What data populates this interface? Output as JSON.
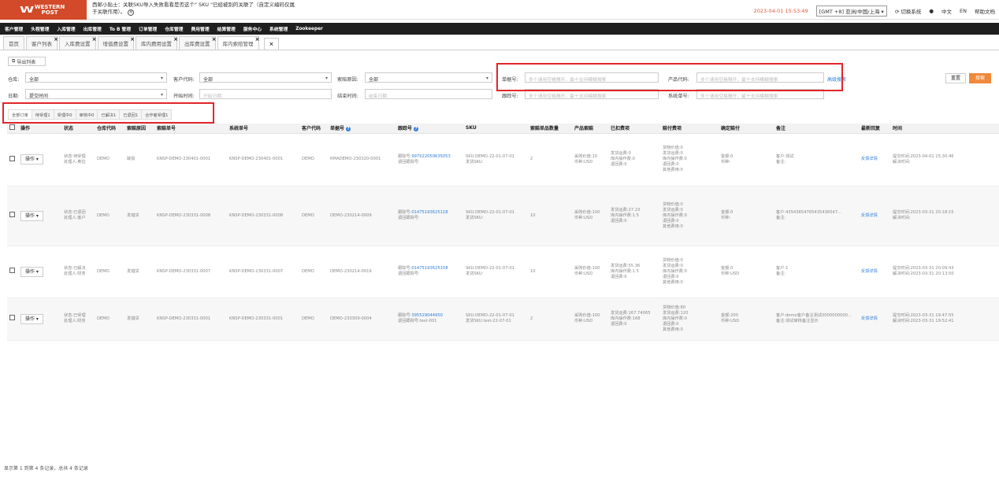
{
  "header": {
    "logo_top": "WESTERN",
    "logo_bottom": "POST",
    "tip": "西邮小贴士：关联SKU导入失败看看是否这个\" SKU \"已经被别的关联了（自定义编码仅属于关联作用）。",
    "datetime": "2023-04-01 15:53:49",
    "timezone": "[GMT +8] 亚洲/中国/上海",
    "switch_system": "切换系统",
    "lang_zh": "中文",
    "lang_en": "EN",
    "help_doc": "帮助文档"
  },
  "nav": [
    "客户管理",
    "头程管理",
    "入库管理",
    "出库管理",
    "To B 管理",
    "订单管理",
    "仓库管理",
    "费用管理",
    "结算管理",
    "服务中心",
    "系统管理",
    "Zookeeper"
  ],
  "tabs": [
    {
      "label": "首页"
    },
    {
      "label": "客户列表"
    },
    {
      "label": "入库费设置"
    },
    {
      "label": "增值费设置"
    },
    {
      "label": "库内费用设置"
    },
    {
      "label": "出库费设置"
    },
    {
      "label": "库内索赔管理"
    }
  ],
  "toolbar": {
    "export": "导出列表"
  },
  "filters": {
    "warehouse_label": "仓库:",
    "warehouse_value": "全部",
    "customer_label": "客户代码:",
    "customer_value": "全部",
    "reason_label": "索赔原因:",
    "reason_value": "全部",
    "order_label": "单据号:",
    "order_ph": "多个请用空格隔开，最十支持模糊搜索",
    "product_label": "产品代码:",
    "product_ph": "多个请用空格隔开，最十支持模糊搜索",
    "advanced": "高级搜索",
    "reset": "重置",
    "search": "搜索",
    "date_label": "日期:",
    "date_value": "提交时间",
    "start_label": "开始时间:",
    "start_ph": "开始日期",
    "end_label": "结束时间:",
    "end_ph": "结束日期",
    "tracking_label": "跟踪号:",
    "tracking_ph": "多个请用空格隔开，最十支持模糊搜索",
    "system_label": "系统单号:",
    "system_ph": "多个请用空格隔开，最十支持模糊搜索"
  },
  "status_tabs": [
    "全部订单",
    "待受理1",
    "受理中0",
    "审核中0",
    "已解决1",
    "已退回1",
    "合作者受理1"
  ],
  "columns": [
    "操作",
    "状态",
    "仓库代码",
    "索赔原因",
    "索赔单号",
    "系统单号",
    "客户代码",
    "单据号",
    "跟踪号",
    "SKU",
    "索赔单品数量",
    "产品索赔",
    "已扣费项",
    "赔付费项",
    "确定赔付",
    "备注",
    "最新回复",
    "时间"
  ],
  "rows": [
    {
      "op": "操作",
      "status": [
        "状态:待受理",
        "处理人:奥拉"
      ],
      "warehouse": "DEMO",
      "reason": "破损",
      "claim_no": "KNSP-DEMO-230401-0001",
      "system_no": "KNSP-DEMO-230401-0001",
      "customer": "DEMO",
      "order_no": "RMADEMO-230320-0001",
      "track_label": "跟踪号:",
      "track_no": "997022050635053",
      "return_track": "退回跟踪号:",
      "sku": [
        "SKU:DEMO-22-01-07-01",
        "发货SKU:"
      ],
      "qty": "2",
      "product_claim": [
        "采购价值:10",
        "币种:USD"
      ],
      "deducted": [
        "发货运费:0",
        "库内操作费:0",
        "退回费:0"
      ],
      "compensation": [
        "货物价值:0",
        "发货运费:0",
        "库内操作费:0",
        "退回费:0",
        "其他费用:0"
      ],
      "confirmed": [
        "金额:0",
        "币种:"
      ],
      "remark": [
        "客户:测试",
        "备注:"
      ],
      "reply": "反馈详情",
      "time": [
        "提交时间:2023-04-01 15:30:46",
        "解决时间:"
      ]
    },
    {
      "op": "操作",
      "status": [
        "状态:已退回",
        "处理人:客户"
      ],
      "warehouse": "DEMO",
      "reason": "发错货",
      "claim_no": "KNSP-DEMO-230331-0008",
      "system_no": "KNSP-DEMO-230331-0008",
      "customer": "DEMO",
      "order_no": "DEMO-230214-0009",
      "track_label": "跟踪号:",
      "track_no": "01475193625118",
      "return_track": "退回跟踪号:",
      "sku": [
        "SKU:DEMO-22-01-07-01",
        "发货SKU:"
      ],
      "qty": "10",
      "product_claim": [
        "采购价值:100",
        "币种:USD"
      ],
      "deducted": [
        "发货运费:27.23",
        "库内操作费:1.5",
        "退回费:0"
      ],
      "compensation": [
        "货物价值:0",
        "发货运费:0",
        "库内操作费:0",
        "退回费:0",
        "其他费用:0"
      ],
      "confirmed": [
        "金额:0",
        "币种:"
      ],
      "remark": [
        "客户:43543654765435436547...",
        "备注:"
      ],
      "reply": "反馈详情",
      "time": [
        "提交时间:2023-03-31 20:18:15",
        "解决时间:"
      ]
    },
    {
      "op": "操作",
      "status": [
        "状态:已解决",
        "处理人:财务"
      ],
      "warehouse": "DEMO",
      "reason": "发错货",
      "claim_no": "KNSP-DEMO-230331-0007",
      "system_no": "KNSP-DEMO-230331-0007",
      "customer": "DEMO",
      "order_no": "DEMO-230214-0019",
      "track_label": "跟踪号:",
      "track_no": "01475193625158",
      "return_track": "退回跟踪号:",
      "sku": [
        "SKU:DEMO-22-01-07-01",
        "发货SKU:"
      ],
      "qty": "10",
      "product_claim": [
        "采购价值:100",
        "币种:USD"
      ],
      "deducted": [
        "发货运费:55.36",
        "库内操作费:1.5",
        "退回费:0"
      ],
      "compensation": [
        "货物价值:0",
        "发货运费:0",
        "库内操作费:0",
        "退回费:0",
        "其他费用:0"
      ],
      "confirmed": [
        "金额:0",
        "币种:USD"
      ],
      "remark": [
        "客户:1",
        "备注:"
      ],
      "reply": "反馈详情",
      "time": [
        "提交时间:2023-03-31 20:09:43",
        "解决时间:2023-03-31 20:13:50"
      ]
    },
    {
      "op": "操作",
      "status": [
        "状态:已受理",
        "处理人:财务"
      ],
      "warehouse": "DEMO",
      "reason": "发错货",
      "claim_no": "KNSP-DEMO-230331-0001",
      "system_no": "KNSP-DEMO-230331-0001",
      "customer": "DEMO",
      "order_no": "DEMO-230309-0004",
      "track_label": "跟踪号:",
      "track_no": "395529044950",
      "return_track": "退回跟踪号:test-001",
      "sku": [
        "SKU:DEMO-22-01-07-01",
        "发货SKU:test-22-07-01"
      ],
      "qty": "2",
      "product_claim": [
        "采购价值:100",
        "币种:USD"
      ],
      "deducted": [
        "发货运费:167.74065",
        "库内操作费:168",
        "退回费:0"
      ],
      "compensation": [
        "货物价值:80",
        "发货运费:120",
        "库内操作费:0",
        "退回费:0",
        "其他费用:0"
      ],
      "confirmed": [
        "金额:200",
        "币种:USD"
      ],
      "remark": [
        "客户:demo客户备注测试0000000000...",
        "备注:测试审核备注显示"
      ],
      "reply": "反馈详情",
      "time": [
        "提交时间:2023-03-31 19:47:55",
        "解决时间:2023-03-31 19:52:41"
      ]
    }
  ],
  "footer": "显示第 1 到第 4 条记录，总共 4 条记录"
}
